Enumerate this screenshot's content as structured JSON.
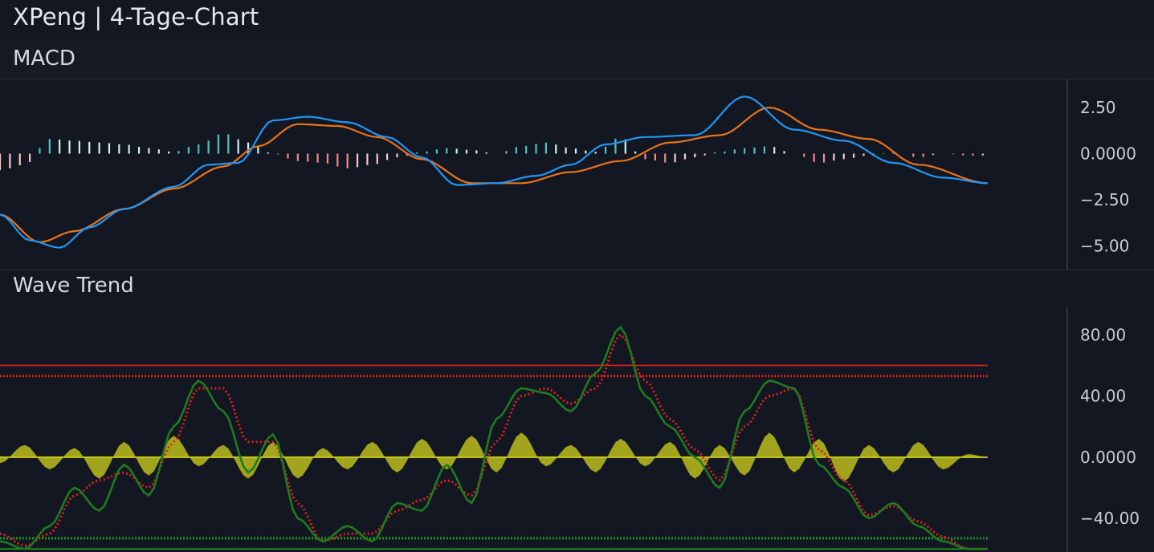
{
  "title": "XPeng | 4-Tage-Chart",
  "colors": {
    "background": "#131722",
    "macd_line": "#2196f3",
    "signal_line": "#e8731a",
    "hist_pos": "#4fc3c3",
    "hist_pos_light": "#d0f0ee",
    "hist_neg": "#f28b8b",
    "hist_neg_light": "#f7c9c9",
    "wt1": "#1f7a1f",
    "wt2": "#e02020",
    "wt_diff_fill": "#c8c81e",
    "ob_line": "#e02020",
    "os_line": "#1f9a1f"
  },
  "panels": {
    "macd": {
      "label": "MACD"
    },
    "wave": {
      "label": "Wave Trend"
    }
  },
  "chart_data": [
    {
      "type": "line",
      "name": "MACD",
      "x_count": 200,
      "ylim": [
        -5.5,
        3.5
      ],
      "yticks": [
        2.5,
        0.0,
        -2.5,
        -5.0
      ],
      "ytick_labels": [
        "2.50",
        "0.0000",
        "−2.50",
        "−5.00"
      ],
      "series": [
        {
          "role": "macd",
          "x": [
            0,
            6,
            12,
            18,
            25,
            35,
            42,
            48,
            55,
            62,
            70,
            78,
            85,
            92,
            100,
            108,
            115,
            122,
            130,
            140,
            150,
            160,
            170,
            180,
            190,
            199
          ],
          "y": [
            -3.3,
            -4.7,
            -5.1,
            -4.0,
            -3.0,
            -1.8,
            -0.6,
            -0.5,
            1.8,
            2.0,
            1.7,
            0.9,
            -0.2,
            -1.7,
            -1.6,
            -1.2,
            -0.6,
            0.5,
            0.9,
            1.0,
            3.1,
            1.3,
            0.7,
            -0.5,
            -1.3,
            -1.6
          ]
        },
        {
          "role": "signal",
          "x": [
            0,
            8,
            15,
            25,
            35,
            45,
            52,
            60,
            68,
            76,
            85,
            95,
            105,
            115,
            125,
            135,
            145,
            155,
            165,
            175,
            185,
            199
          ],
          "y": [
            -3.3,
            -4.8,
            -4.2,
            -3.0,
            -1.9,
            -0.7,
            0.4,
            1.6,
            1.5,
            0.9,
            -0.3,
            -1.6,
            -1.6,
            -1.0,
            -0.4,
            0.6,
            1.0,
            2.5,
            1.3,
            0.8,
            -0.6,
            -1.6
          ]
        },
        {
          "role": "histogram",
          "x": [
            0,
            5,
            10,
            15,
            20,
            25,
            30,
            35,
            40,
            45,
            50,
            55,
            60,
            65,
            70,
            75,
            80,
            85,
            90,
            95,
            100,
            105,
            110,
            115,
            120,
            125,
            130,
            135,
            140,
            145,
            150,
            155,
            160,
            165,
            170,
            175,
            180,
            185,
            190,
            195,
            199
          ],
          "y": [
            -0.9,
            -0.6,
            0.8,
            0.7,
            0.6,
            0.5,
            0.3,
            0.1,
            0.5,
            1.1,
            0.6,
            0.0,
            -0.4,
            -0.5,
            -0.8,
            -0.6,
            -0.2,
            0.1,
            0.3,
            0.2,
            0.0,
            0.4,
            0.6,
            0.3,
            0.1,
            0.9,
            -0.3,
            -0.5,
            -0.2,
            0.1,
            0.3,
            0.4,
            0.0,
            -0.5,
            -0.3,
            -0.1,
            0.1,
            -0.2,
            0.0,
            -0.1,
            -0.1
          ]
        }
      ]
    },
    {
      "type": "line",
      "name": "Wave Trend",
      "x_count": 200,
      "ylim": [
        -62,
        98
      ],
      "yticks": [
        80,
        40,
        0,
        -40
      ],
      "ytick_labels": [
        "80.00",
        "40.00",
        "0.0000",
        "−40.00"
      ],
      "levels": [
        60,
        53,
        -53,
        -60
      ],
      "series": [
        {
          "role": "wt1",
          "x": [
            0,
            5,
            10,
            15,
            20,
            25,
            30,
            35,
            40,
            45,
            50,
            55,
            60,
            65,
            70,
            75,
            80,
            85,
            90,
            95,
            100,
            105,
            110,
            115,
            120,
            125,
            130,
            135,
            140,
            145,
            150,
            155,
            160,
            165,
            170,
            175,
            180,
            185,
            190,
            195,
            199
          ],
          "y": [
            -55,
            -60,
            -45,
            -20,
            -35,
            -5,
            -25,
            20,
            50,
            30,
            -10,
            15,
            -40,
            -55,
            -45,
            -55,
            -30,
            -35,
            -5,
            -30,
            25,
            45,
            42,
            30,
            55,
            85,
            40,
            20,
            0,
            -20,
            30,
            50,
            45,
            -5,
            -20,
            -40,
            -30,
            -45,
            -55,
            -60,
            -60
          ]
        },
        {
          "role": "wt2",
          "x": [
            0,
            5,
            10,
            15,
            20,
            25,
            30,
            35,
            40,
            45,
            50,
            55,
            60,
            65,
            70,
            75,
            80,
            85,
            90,
            95,
            100,
            105,
            110,
            115,
            120,
            125,
            130,
            135,
            140,
            145,
            150,
            155,
            160,
            165,
            170,
            175,
            180,
            185,
            190,
            195,
            199
          ],
          "y": [
            -50,
            -58,
            -50,
            -25,
            -15,
            -10,
            -20,
            10,
            45,
            45,
            10,
            10,
            -30,
            -55,
            -50,
            -50,
            -35,
            -28,
            -15,
            -25,
            10,
            40,
            45,
            35,
            45,
            80,
            50,
            25,
            5,
            -15,
            20,
            40,
            45,
            5,
            -15,
            -38,
            -32,
            -42,
            -52,
            -60,
            -60
          ]
        },
        {
          "role": "diff",
          "x": [
            0,
            5,
            10,
            15,
            20,
            25,
            30,
            35,
            40,
            45,
            50,
            55,
            60,
            65,
            70,
            75,
            80,
            85,
            90,
            95,
            100,
            105,
            110,
            115,
            120,
            125,
            130,
            135,
            140,
            145,
            150,
            155,
            160,
            165,
            170,
            175,
            180,
            185,
            190,
            195,
            199
          ],
          "y": [
            -4,
            8,
            -8,
            6,
            -14,
            10,
            -12,
            14,
            -6,
            8,
            -14,
            10,
            -14,
            6,
            -8,
            10,
            -10,
            12,
            -8,
            14,
            -10,
            16,
            -6,
            8,
            -10,
            12,
            -6,
            10,
            -14,
            8,
            -12,
            16,
            -10,
            12,
            -16,
            8,
            -10,
            10,
            -8,
            2,
            0
          ]
        }
      ]
    }
  ]
}
